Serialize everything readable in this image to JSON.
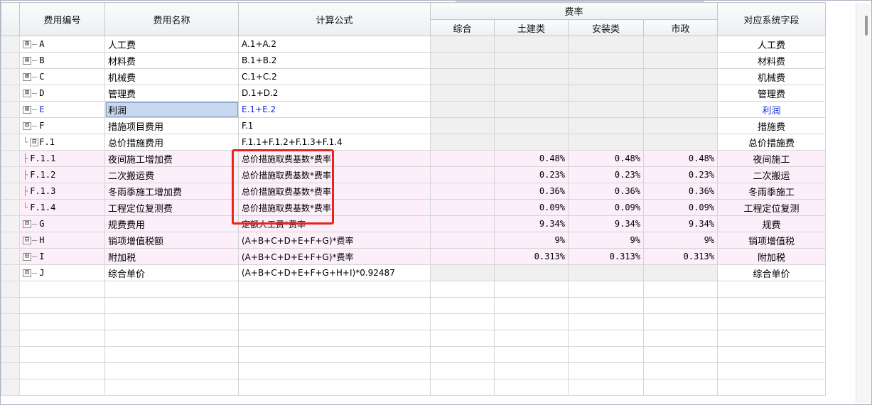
{
  "headers": {
    "code": "费用编号",
    "name": "费用名称",
    "formula": "计算公式",
    "rate_group": "费率",
    "rate_sub": [
      "综合",
      "土建类",
      "安装类",
      "市政"
    ],
    "field": "对应系统字段"
  },
  "rows": [
    {
      "code": "A",
      "name": "人工费",
      "formula": "A.1+A.2",
      "rates": [
        "",
        "",
        "",
        ""
      ],
      "field": "人工费"
    },
    {
      "code": "B",
      "name": "材料费",
      "formula": "B.1+B.2",
      "rates": [
        "",
        "",
        "",
        ""
      ],
      "field": "材料费"
    },
    {
      "code": "C",
      "name": "机械费",
      "formula": "C.1+C.2",
      "rates": [
        "",
        "",
        "",
        ""
      ],
      "field": "机械费"
    },
    {
      "code": "D",
      "name": "管理费",
      "formula": "D.1+D.2",
      "rates": [
        "",
        "",
        "",
        ""
      ],
      "field": "管理费"
    },
    {
      "code": "E",
      "name": "利润",
      "formula": "E.1+E.2",
      "rates": [
        "",
        "",
        "",
        ""
      ],
      "field": "利润"
    },
    {
      "code": "F",
      "name": "措施项目费用",
      "formula": "F.1",
      "rates": [
        "",
        "",
        "",
        ""
      ],
      "field": "措施费"
    },
    {
      "code": "F.1",
      "name": "总价措施费用",
      "formula": "F.1.1+F.1.2+F.1.3+F.1.4",
      "rates": [
        "",
        "",
        "",
        ""
      ],
      "field": "总价措施费"
    },
    {
      "code": "F.1.1",
      "name": "夜间施工增加费",
      "formula": "总价措施取费基数*费率",
      "rates": [
        "",
        "0.48%",
        "0.48%",
        "0.48%"
      ],
      "field": "夜间施工"
    },
    {
      "code": "F.1.2",
      "name": "二次搬运费",
      "formula": "总价措施取费基数*费率",
      "rates": [
        "",
        "0.23%",
        "0.23%",
        "0.23%"
      ],
      "field": "二次搬运"
    },
    {
      "code": "F.1.3",
      "name": "冬雨季施工增加费",
      "formula": "总价措施取费基数*费率",
      "rates": [
        "",
        "0.36%",
        "0.36%",
        "0.36%"
      ],
      "field": "冬雨季施工"
    },
    {
      "code": "F.1.4",
      "name": "工程定位复测费",
      "formula": "总价措施取费基数*费率",
      "rates": [
        "",
        "0.09%",
        "0.09%",
        "0.09%"
      ],
      "field": "工程定位复测"
    },
    {
      "code": "G",
      "name": "规费费用",
      "formula": "定额人工费*费率",
      "rates": [
        "",
        "9.34%",
        "9.34%",
        "9.34%"
      ],
      "field": "规费"
    },
    {
      "code": "H",
      "name": "销项增值税额",
      "formula": "(A+B+C+D+E+F+G)*费率",
      "rates": [
        "",
        "9%",
        "9%",
        "9%"
      ],
      "field": "销项增值税"
    },
    {
      "code": "I",
      "name": "附加税",
      "formula": "(A+B+C+D+E+F+G)*费率",
      "rates": [
        "",
        "0.313%",
        "0.313%",
        "0.313%"
      ],
      "field": "附加税"
    },
    {
      "code": "J",
      "name": "综合单价",
      "formula": "(A+B+C+D+E+F+G+H+I)*0.92487",
      "rates": [
        "",
        "",
        "",
        ""
      ],
      "field": "综合单价"
    }
  ],
  "tree_icons": {
    "expanded": "⊟",
    "collapsed": "⊞"
  },
  "colors": {
    "highlight_box": "#e8241d",
    "row_pink": "#fceffa",
    "selected_text": "#1a2bd8"
  }
}
